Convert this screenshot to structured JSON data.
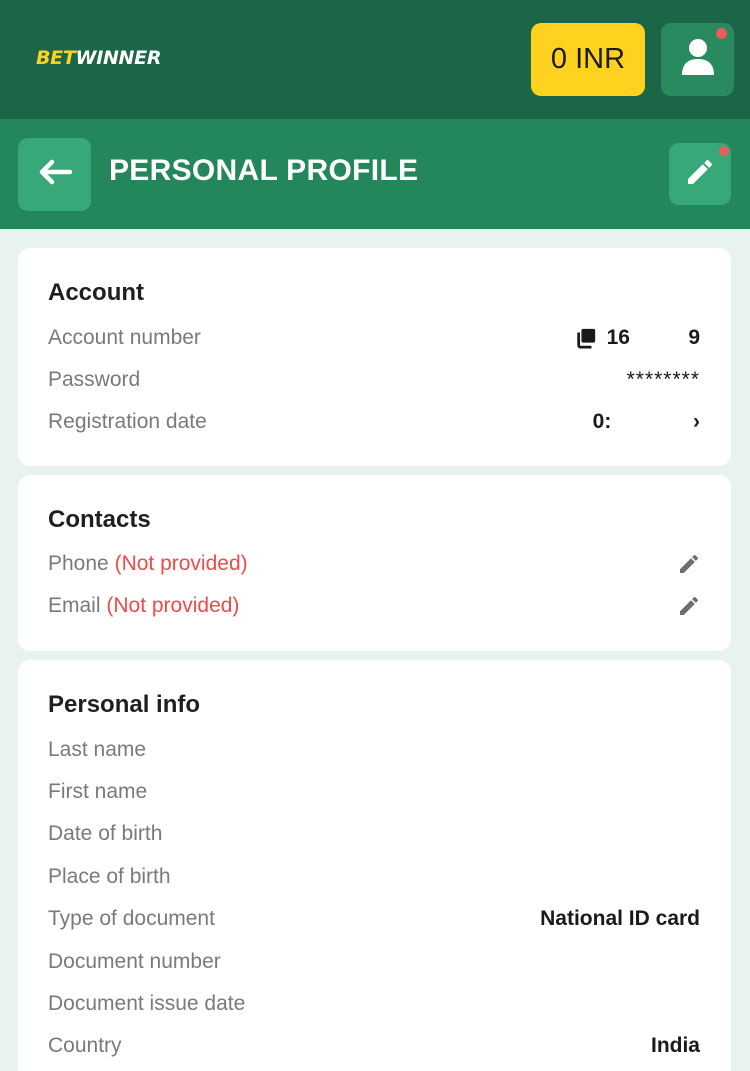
{
  "header": {
    "logo_part1": "BET",
    "logo_part2": "WINNER",
    "balance": "0 INR",
    "user_icon": "user-icon",
    "notification_color": "#f05a5a"
  },
  "subheader": {
    "back_icon": "arrow-left-icon",
    "title": "PERSONAL PROFILE",
    "edit_icon": "pencil-icon"
  },
  "account": {
    "title": "Account",
    "rows": [
      {
        "label": "Account number",
        "value": "16          9",
        "icon": "copy-icon"
      },
      {
        "label": "Password",
        "value": "********"
      },
      {
        "label": "Registration date",
        "value": "0:              ›"
      }
    ]
  },
  "contacts": {
    "title": "Contacts",
    "rows": [
      {
        "label": "Phone",
        "status": "(Not provided)",
        "icon": "pencil-icon"
      },
      {
        "label": "Email",
        "status": "(Not provided)",
        "icon": "pencil-icon"
      }
    ]
  },
  "personal_info": {
    "title": "Personal info",
    "rows": [
      {
        "label": "Last name",
        "value": ""
      },
      {
        "label": "First name",
        "value": ""
      },
      {
        "label": "Date of birth",
        "value": ""
      },
      {
        "label": "Place of birth",
        "value": ""
      },
      {
        "label": "Type of document",
        "value": "National ID card"
      },
      {
        "label": "Document number",
        "value": ""
      },
      {
        "label": "Document issue date",
        "value": ""
      },
      {
        "label": "Country",
        "value": "India"
      }
    ]
  },
  "colors": {
    "top_bar": "#1a6646",
    "sub_bar": "#24875c",
    "button_green": "#37a877",
    "accent_yellow": "#ffd21f",
    "error_red": "#f04a4a"
  }
}
